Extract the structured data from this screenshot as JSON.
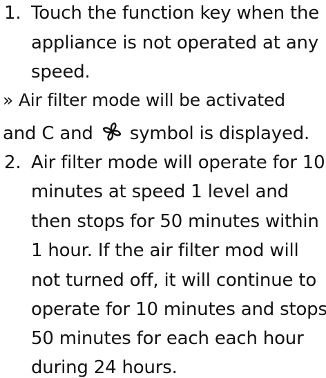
{
  "steps": [
    {
      "number": "1.",
      "lines": [
        "Touch the function key when the",
        "appliance is not operated at any",
        "speed."
      ]
    },
    {
      "number": "2.",
      "lines": [
        "Air filter mode will operate for 10",
        "minutes at speed 1 level and",
        "then stops for 50 minutes within",
        "1 hour. If the air filter mod will",
        "not turned off, it will continue to",
        "operate for 10 minutes and stops",
        "50 minutes for each each hour",
        "during 24 hours."
      ]
    }
  ],
  "result": {
    "line1": "» Air filter mode will be activated",
    "line2_before": "and C and",
    "line2_icon": "fan-icon",
    "line2_after": "symbol is displayed."
  }
}
